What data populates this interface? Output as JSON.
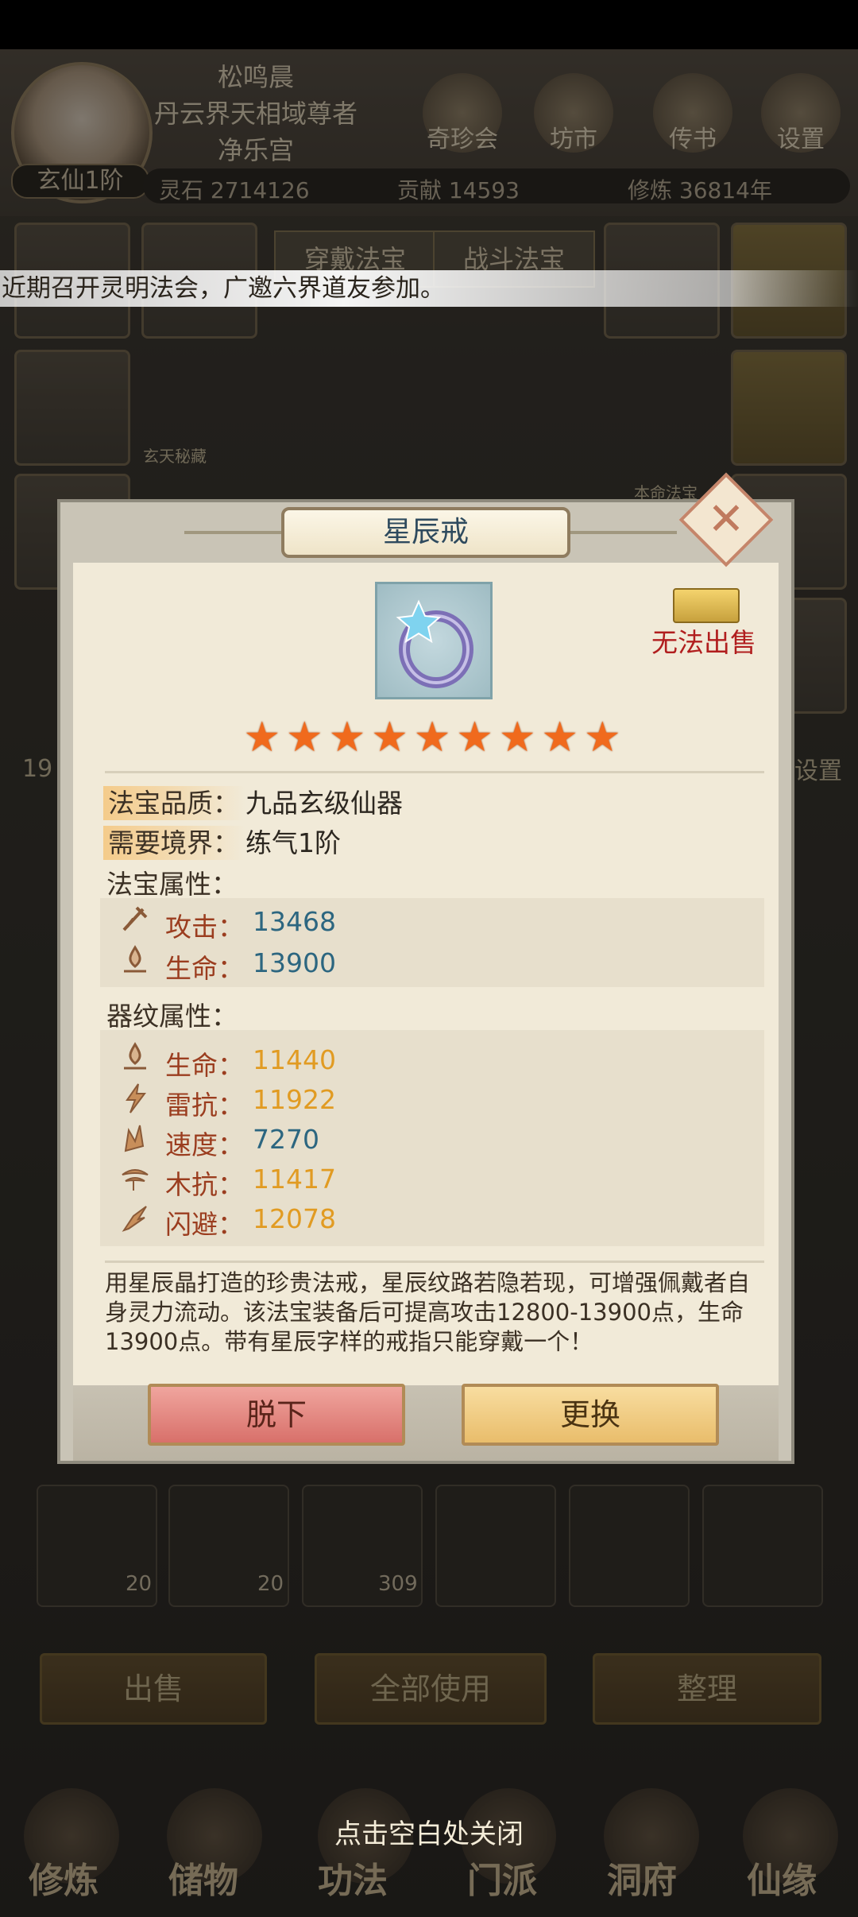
{
  "player": {
    "name": "松鸣晨",
    "title": "丹云界天相域尊者",
    "sect": "净乐宫",
    "realm": "玄仙1阶"
  },
  "top_menu": [
    {
      "label": "奇珍会"
    },
    {
      "label": "坊市"
    },
    {
      "label": "传书"
    },
    {
      "label": "设置"
    }
  ],
  "resources": {
    "spirit_stone": "灵石 2714126",
    "contribution": "贡献 14593",
    "cultivation": "修炼 36814年"
  },
  "tabs": {
    "wear": "穿戴法宝",
    "battle": "战斗法宝"
  },
  "broadcast": "近期召开灵明法会，广邀六界道友参加。",
  "side_labels": {
    "secret": "玄天秘藏",
    "origin": "本命法宝",
    "settings": "设置",
    "left_num": "19"
  },
  "inventory": {
    "counts": [
      "20",
      "20",
      "309"
    ]
  },
  "bottom_buttons": {
    "sell": "出售",
    "use_all": "全部使用",
    "arrange": "整理"
  },
  "nav": [
    "修炼",
    "储物",
    "功法",
    "门派",
    "洞府",
    "仙缘"
  ],
  "close_hint": "点击空白处关闭",
  "item": {
    "name": "星辰戒",
    "stars": 9,
    "cannot_sell": "无法出售",
    "quality_label": "法宝品质：",
    "quality_value": "九品玄级仙器",
    "realm_label": "需要境界：",
    "realm_value": "练气1阶",
    "base_section": "法宝属性：",
    "base_attrs": [
      {
        "icon": "attack-icon",
        "name": "攻击：",
        "value": "13468",
        "color": "#2c6680"
      },
      {
        "icon": "life-icon",
        "name": "生命：",
        "value": "13900",
        "color": "#2c6680"
      }
    ],
    "rune_section": "器纹属性：",
    "rune_attrs": [
      {
        "icon": "life-icon",
        "name": "生命：",
        "value": "11440",
        "color": "#e19b22"
      },
      {
        "icon": "thunder-resist-icon",
        "name": "雷抗：",
        "value": "11922",
        "color": "#e19b22"
      },
      {
        "icon": "speed-icon",
        "name": "速度：",
        "value": "7270",
        "color": "#2c6680"
      },
      {
        "icon": "wood-resist-icon",
        "name": "木抗：",
        "value": "11417",
        "color": "#e19b22"
      },
      {
        "icon": "dodge-icon",
        "name": "闪避：",
        "value": "12078",
        "color": "#e19b22"
      }
    ],
    "description": "用星辰晶打造的珍贵法戒，星辰纹路若隐若现，可增强佩戴者自身灵力流动。该法宝装备后可提高攻击12800-13900点，生命13900点。带有星辰字样的戒指只能穿戴一个！",
    "unequip_button": "脱下",
    "replace_button": "更换"
  }
}
